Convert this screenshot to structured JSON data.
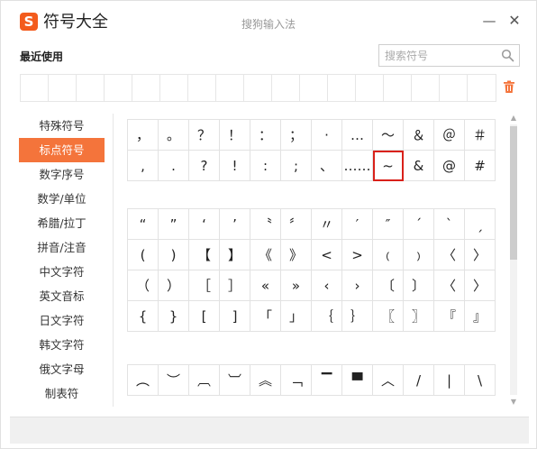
{
  "window": {
    "logo_letter": "S",
    "app_title": "符号大全",
    "center_title": "搜狗输入法",
    "minimize_glyph": "—",
    "close_glyph": "✕"
  },
  "recent": {
    "label": "最近使用",
    "slots": 17
  },
  "search": {
    "placeholder": "搜索符号",
    "value": ""
  },
  "icons": {
    "logo": "sogou-logo-icon",
    "search": "search-icon",
    "trash": "trash-icon",
    "accent_color": "#f4743b",
    "selection_color": "#d9211a"
  },
  "categories": [
    {
      "label": "特殊符号",
      "active": false
    },
    {
      "label": "标点符号",
      "active": true
    },
    {
      "label": "数字序号",
      "active": false
    },
    {
      "label": "数学/单位",
      "active": false
    },
    {
      "label": "希腊/拉丁",
      "active": false
    },
    {
      "label": "拼音/注音",
      "active": false
    },
    {
      "label": "中文字符",
      "active": false
    },
    {
      "label": "英文音标",
      "active": false
    },
    {
      "label": "日文字符",
      "active": false
    },
    {
      "label": "韩文字符",
      "active": false
    },
    {
      "label": "俄文字母",
      "active": false
    },
    {
      "label": "制表符",
      "active": false
    }
  ],
  "symbol_tables": [
    {
      "rows": [
        [
          "，",
          "。",
          "？",
          "！",
          "：",
          "；",
          "·",
          "…",
          "～",
          "＆",
          "＠",
          "＃"
        ],
        [
          ",",
          ".",
          "?",
          "!",
          ":",
          ";",
          "、",
          "……",
          "~",
          "&",
          "@",
          "#"
        ]
      ],
      "selected": [
        1,
        8
      ]
    },
    {
      "rows": [
        [
          "“",
          "”",
          "‘",
          "’",
          "〝",
          "〞",
          "〃",
          "′",
          "″",
          "ˊ",
          "ˋ",
          "ˏ"
        ],
        [
          "(",
          ")",
          "【",
          "】",
          "《",
          "》",
          "<",
          ">",
          "﹙",
          "﹚",
          "〈",
          "〉"
        ],
        [
          "（",
          "）",
          "［",
          "］",
          "«",
          "»",
          "‹",
          "›",
          "〔",
          "〕",
          "〈",
          "〉"
        ],
        [
          "{",
          "}",
          "[",
          "]",
          "「",
          "」",
          "｛",
          "｝",
          "〖",
          "〗",
          "『",
          "』"
        ]
      ]
    },
    {
      "rows": [
        [
          "︵",
          "︶",
          "︹",
          "︺",
          "︽",
          "﹁",
          "▔",
          "▀",
          "︿",
          "/",
          "|",
          "\\"
        ]
      ]
    }
  ],
  "scrollbar": {
    "up_glyph": "▲",
    "down_glyph": "▼",
    "scroll_fraction": 0.0
  }
}
